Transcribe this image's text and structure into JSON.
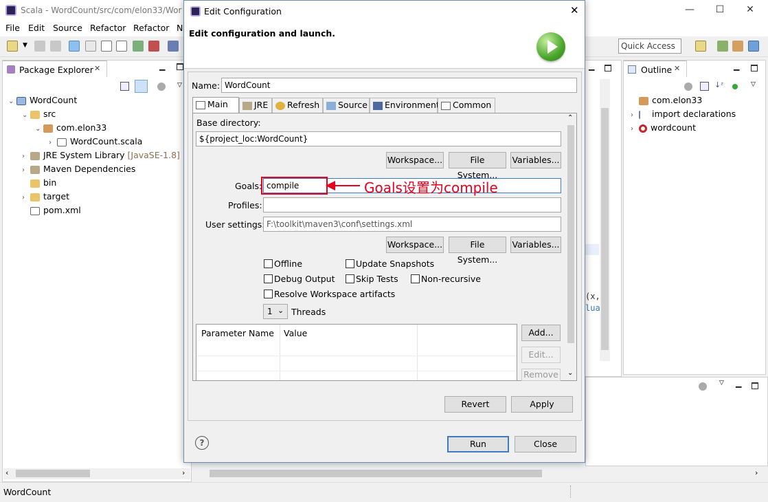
{
  "window": {
    "title": "Scala - WordCount/src/com/elon33/Wor",
    "minimize": "—",
    "maximize": "☐",
    "close": "✕"
  },
  "menu": [
    "File",
    "Edit",
    "Source",
    "Refactor",
    "Refactor",
    "N"
  ],
  "quick_access": "Quick Access",
  "package_explorer": {
    "tab_label": "Package Explorer",
    "tree": [
      {
        "label": "WordCount",
        "extra": "",
        "icon": "project-icon"
      },
      {
        "label": "src",
        "extra": "",
        "icon": "folder-icon"
      },
      {
        "label": "com.elon33",
        "extra": "",
        "icon": "package-icon"
      },
      {
        "label": "WordCount.scala",
        "extra": "",
        "icon": "scala-file-icon"
      },
      {
        "label": "JRE System Library",
        "extra": "[JavaSE-1.8]",
        "icon": "library-icon"
      },
      {
        "label": "Maven Dependencies",
        "extra": "",
        "icon": "library-icon"
      },
      {
        "label": "bin",
        "extra": "",
        "icon": "folder-icon"
      },
      {
        "label": "target",
        "extra": "",
        "icon": "folder-icon"
      },
      {
        "label": "pom.xml",
        "extra": "",
        "icon": "xml-file-icon"
      }
    ]
  },
  "outline": {
    "tab_label": "Outline",
    "items": [
      {
        "label": "com.elon33"
      },
      {
        "label": "import declarations"
      },
      {
        "label": "wordcount"
      }
    ]
  },
  "editor_peek": {
    "line1": "(x,",
    "line2": "lua"
  },
  "dialog": {
    "title": "Edit Configuration",
    "header": "Edit configuration and launch.",
    "name_label": "Name:",
    "name_value": "WordCount",
    "tabs": [
      "Main",
      "JRE",
      "Refresh",
      "Source",
      "Environment",
      "Common"
    ],
    "base_dir_label": "Base directory:",
    "base_dir_value": "${project_loc:WordCount}",
    "workspace_btn": "Workspace...",
    "filesystem_btn": "File System...",
    "variables_btn": "Variables...",
    "goals_label": "Goals:",
    "goals_value": "compile",
    "profiles_label": "Profiles:",
    "profiles_value": "",
    "user_settings_label": "User settings:",
    "user_settings_value": "F:\\toolkit\\maven3\\conf\\settings.xml",
    "checkboxes": {
      "offline": "Offline",
      "update_snapshots": "Update Snapshots",
      "debug_output": "Debug Output",
      "skip_tests": "Skip Tests",
      "non_recursive": "Non-recursive",
      "resolve_workspace": "Resolve Workspace artifacts"
    },
    "threads_value": "1",
    "threads_label": "Threads",
    "param_table": {
      "headers": [
        "Parameter Name",
        "Value"
      ]
    },
    "add_btn": "Add...",
    "edit_btn": "Edit...",
    "remove_btn": "Remove",
    "revert_btn": "Revert",
    "apply_btn": "Apply",
    "run_btn": "Run",
    "close_btn": "Close"
  },
  "annotation": {
    "text": "Goals设置为compile",
    "color": "#e8001c"
  },
  "status": {
    "text": "WordCount"
  }
}
